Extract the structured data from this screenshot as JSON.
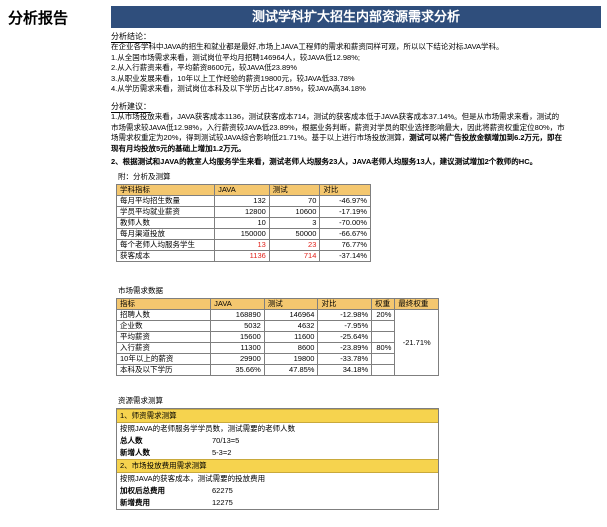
{
  "page": {
    "section_label": "分析报告",
    "banner_title": "测试学科扩大招生内部资源需求分析"
  },
  "conclusion": {
    "heading": "分析结论：",
    "lines": [
      "在企业各学科中JAVA的招生和就业都是最好,市场上JAVA工程师的需求和薪资同样可观，所以以下结论对标JAVA学科。",
      "1.从全国市场需求来看，测试岗位平均月招聘146964人，较JAVA低12.98%;",
      "2.从入行薪资来看，平均薪资8600元，较JAVA低23.89%",
      "3.从职业发展来看，10年以上工作经验的薪资19800元，较JAVA低33.78%",
      "4.从学历需求来看，测试岗位本科及以下学历占比47.85%，较JAVA高34.18%"
    ]
  },
  "advice": {
    "heading": "分析建议：",
    "line1": "1.从市场投放来看，JAVA获客成本1136，测试获客成本714，测试的获客成本低于JAVA获客成本37.14%。但是从市场需求来看，测试的",
    "line2": "市场需求较JAVA低12.98%，入行薪资较JAVA低23.89%，根据业务判断，薪资对学员的职业选择影响最大，因此将薪资权重定位80%，市",
    "line3_normal": "场需求权重定为20%，得到测试较JAVA综合影响低21.71%。基于以上进行市场投放测算，",
    "line3_bold": "测试可以将广告投放金额增加到6.2万元，即在",
    "line4": "现有月均投放5元的基础上增加1.2万元。",
    "line5": "2、根据测试和JAVA的教室人均服务学生来看，测试老师人均服务23人，JAVA老师人均服务13人，建议测试增加2个教师的HC。"
  },
  "table1": {
    "title": "附：分析及测算",
    "headers": [
      "学科指标",
      "JAVA",
      "测试",
      "对比"
    ],
    "rows": [
      {
        "label": "每月平均招生数量",
        "java": "132",
        "test": "70",
        "diff": "-46.97%"
      },
      {
        "label": "学员平均就业薪资",
        "java": "12800",
        "test": "10600",
        "diff": "-17.19%"
      },
      {
        "label": "教师人数",
        "java": "10",
        "test": "3",
        "diff": "-70.00%"
      },
      {
        "label": "每月渠道投放",
        "java": "150000",
        "test": "50000",
        "diff": "-66.67%"
      },
      {
        "label": "每个老师人均服务学生",
        "java": "13",
        "test": "23",
        "diff": "76.77%"
      },
      {
        "label": "获客成本",
        "java": "1136",
        "test": "714",
        "diff": "-37.14%"
      }
    ],
    "highlight_color": "#e0221b"
  },
  "table2": {
    "title": "市场需求数据",
    "headers": [
      "指标",
      "JAVA",
      "测试",
      "对比",
      "权重",
      "最终权重"
    ],
    "rows": [
      {
        "label": "招聘人数",
        "java": "168890",
        "test": "146964",
        "diff": "-12.98%",
        "weight": "20%"
      },
      {
        "label": "企业数",
        "java": "5032",
        "test": "4632",
        "diff": "-7.95%",
        "weight": ""
      },
      {
        "label": "平均薪资",
        "java": "15600",
        "test": "11600",
        "diff": "-25.64%",
        "weight": ""
      },
      {
        "label": "入行薪资",
        "java": "11300",
        "test": "8600",
        "diff": "-23.89%",
        "weight": "80%"
      },
      {
        "label": "10年以上的薪资",
        "java": "29900",
        "test": "19800",
        "diff": "-33.78%",
        "weight": ""
      },
      {
        "label": "本科及以下学历",
        "java": "35.66%",
        "test": "47.85%",
        "diff": "34.18%",
        "weight": ""
      }
    ],
    "final_weight": "-21.71%"
  },
  "resource": {
    "title": "资源需求测算",
    "part1": {
      "heading": "1、师资需求测算",
      "desc": "按照JAVA的老师服务学学员数，测试需要的老师人数",
      "k1": "总人数",
      "v1": "70/13=5",
      "k2": "新增人数",
      "v2": "5-3=2"
    },
    "part2": {
      "heading": "2、市场投放费用需求测算",
      "desc": "按照JAVA的获客成本，测试需要的投放费用",
      "k1": "加权后总费用",
      "v1": "62275",
      "k2": "新增费用",
      "v2": "12275"
    }
  },
  "colors": {
    "banner": "#2f4e7c",
    "table_header": "#f4c76f",
    "resource_bar": "#f6d34e"
  }
}
